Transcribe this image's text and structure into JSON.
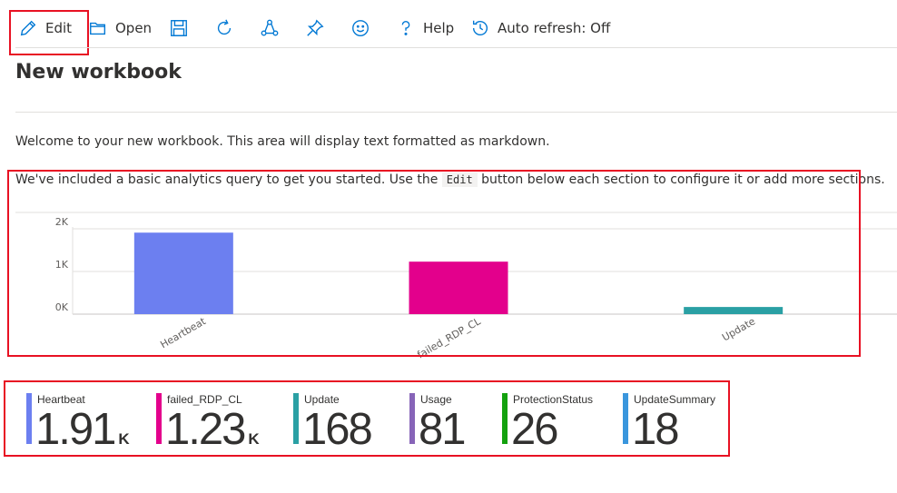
{
  "toolbar": {
    "edit": "Edit",
    "open": "Open",
    "help": "Help",
    "auto_refresh": "Auto refresh: Off"
  },
  "page": {
    "title": "New workbook",
    "intro": "Welcome to your new workbook. This area will display text formatted as markdown.",
    "query_pre": "We've included a basic analytics query to get you started. Use the ",
    "query_code": "Edit",
    "query_post": " button below each section to configure it or add more sections."
  },
  "chart_data": {
    "type": "bar",
    "categories": [
      "Heartbeat",
      "failed_RDP_CL",
      "Update"
    ],
    "values": [
      1910,
      1230,
      168
    ],
    "colors": [
      "#6c7ff0",
      "#e3008c",
      "#2aa0a4"
    ],
    "y_ticks": [
      "0K",
      "1K",
      "2K"
    ],
    "ylim": [
      0,
      2000
    ],
    "grid": true
  },
  "tiles": [
    {
      "label": "Heartbeat",
      "value": "1.91",
      "unit": "K",
      "color": "#6c7ff0"
    },
    {
      "label": "failed_RDP_CL",
      "value": "1.23",
      "unit": "K",
      "color": "#e3008c"
    },
    {
      "label": "Update",
      "value": "168",
      "unit": "",
      "color": "#2aa0a4"
    },
    {
      "label": "Usage",
      "value": "81",
      "unit": "",
      "color": "#8764b8"
    },
    {
      "label": "ProtectionStatus",
      "value": "26",
      "unit": "",
      "color": "#13a10e"
    },
    {
      "label": "UpdateSummary",
      "value": "18",
      "unit": "",
      "color": "#3a96dd"
    }
  ]
}
